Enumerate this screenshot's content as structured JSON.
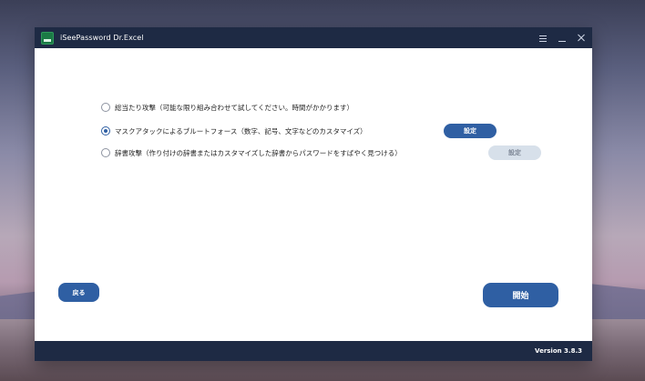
{
  "app": {
    "title": "iSeePassword Dr.Excel",
    "icon_label": "Excel"
  },
  "options": [
    {
      "label": "総当たり攻撃（可能な限り組み合わせて試してください。時間がかかります）",
      "selected": false
    },
    {
      "label": "マスクアタックによるブルートフォース（数字、記号、文字などのカスタマイズ）",
      "selected": true
    },
    {
      "label": "辞書攻撃（作り付けの辞書またはカスタマイズした辞書からパスワードをすばやく見つける）",
      "selected": false
    }
  ],
  "buttons": {
    "mask_settings": "設定",
    "dictionary_settings": "設定",
    "back": "戻る",
    "start": "開始"
  },
  "footer": {
    "version": "Version 3.8.3"
  },
  "colors": {
    "titlebar": "#1e2a44",
    "accent": "#2f5fa3",
    "disabled": "#d7e0ea"
  }
}
